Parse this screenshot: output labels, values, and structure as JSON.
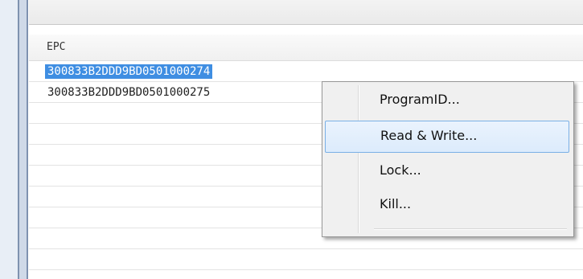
{
  "list": {
    "column_header": "EPC",
    "rows": [
      {
        "epc": "300833B2DDD9BD0501000274",
        "selected": true
      },
      {
        "epc": "300833B2DDD9BD0501000275",
        "selected": false
      }
    ]
  },
  "context_menu": {
    "items": [
      {
        "label": "ProgramID..."
      },
      {
        "label": "Read & Write...",
        "hovered": true
      },
      {
        "label": "Lock..."
      },
      {
        "label": "Kill..."
      }
    ]
  },
  "colors": {
    "selection": "#3f8ee2",
    "menu_hover_border": "#7ab0e6",
    "menu_background": "#f0f0f0"
  }
}
